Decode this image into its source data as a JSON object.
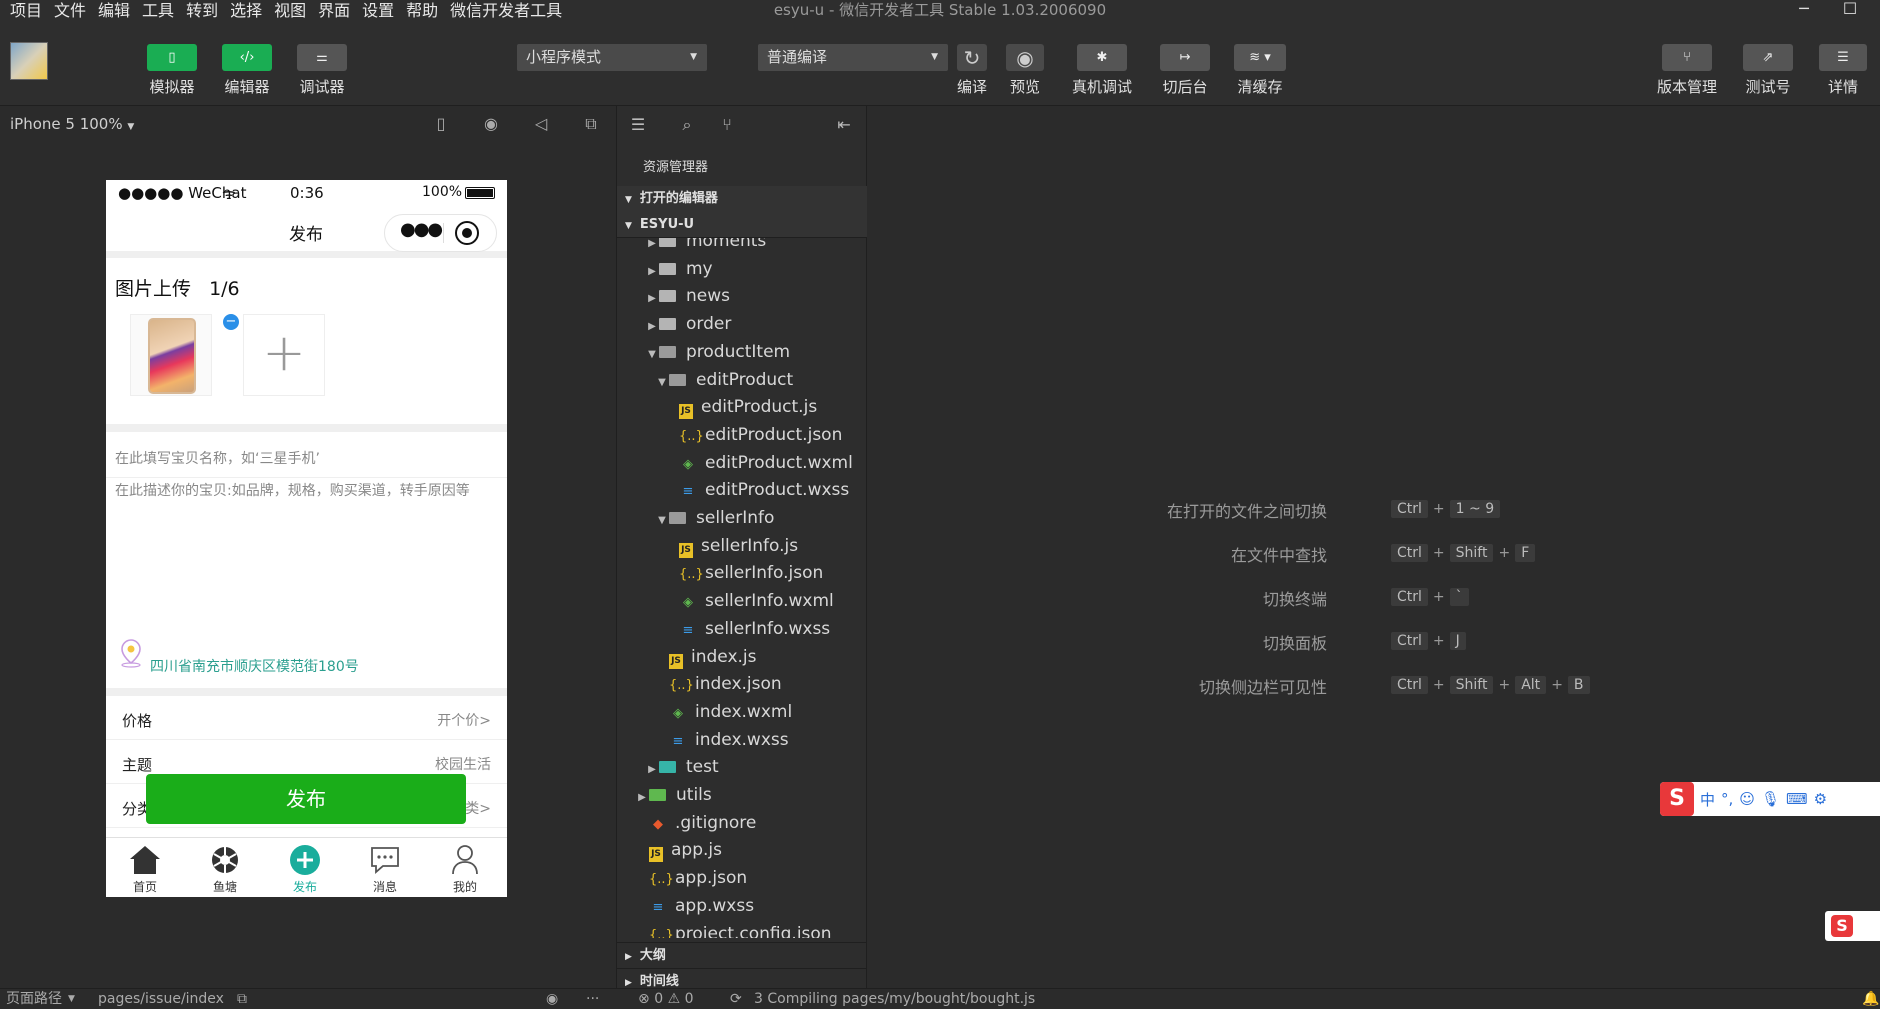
{
  "menubar": {
    "items": [
      "项目",
      "文件",
      "编辑",
      "工具",
      "转到",
      "选择",
      "视图",
      "界面",
      "设置",
      "帮助",
      "微信开发者工具"
    ],
    "title": "esyu-u - 微信开发者工具 Stable 1.03.2006090"
  },
  "toolbar": {
    "simulator": "模拟器",
    "editor": "编辑器",
    "debugger": "调试器",
    "mode_select": "小程序模式",
    "compile_select": "普通编译",
    "compile": "编译",
    "preview": "预览",
    "remote_debug": "真机调试",
    "background": "切后台",
    "clear_cache": "清缓存",
    "version": "版本管理",
    "test_account": "测试号",
    "details": "详情"
  },
  "simulator": {
    "device": "iPhone 5 100%",
    "status_carrier": "●●●●● WeChat",
    "status_time": "0:36",
    "status_battery": "100%",
    "nav_title": "发布",
    "upload_title": "图片上传",
    "upload_count": "1/6",
    "name_placeholder": "在此填写宝贝名称，如‘三星手机’",
    "desc_placeholder": "在此描述你的宝贝:如品牌，规格，购买渠道，转手原因等",
    "location": "四川省南充市顺庆区模范街180号",
    "rows": [
      {
        "label": "价格",
        "value": "开个价>"
      },
      {
        "label": "主题",
        "value": "校园生活"
      },
      {
        "label": "分类",
        "value": "类>"
      }
    ],
    "publish_button": "发布",
    "tabs": [
      "首页",
      "鱼塘",
      "发布",
      "消息",
      "我的"
    ]
  },
  "explorer": {
    "title": "资源管理器",
    "open_editors": "打开的编辑器",
    "project": "ESYU-U",
    "outline": "大纲",
    "timeline": "时间线",
    "tree": [
      {
        "name": "moments",
        "type": "folder"
      },
      {
        "name": "my",
        "type": "folder"
      },
      {
        "name": "news",
        "type": "folder"
      },
      {
        "name": "order",
        "type": "folder"
      },
      {
        "name": "productItem",
        "type": "folder-open"
      },
      {
        "name": "editProduct",
        "type": "folder-open"
      },
      {
        "name": "editProduct.js",
        "type": "js"
      },
      {
        "name": "editProduct.json",
        "type": "json"
      },
      {
        "name": "editProduct.wxml",
        "type": "wxml"
      },
      {
        "name": "editProduct.wxss",
        "type": "wxss"
      },
      {
        "name": "sellerInfo",
        "type": "folder-open"
      },
      {
        "name": "sellerInfo.js",
        "type": "js"
      },
      {
        "name": "sellerInfo.json",
        "type": "json"
      },
      {
        "name": "sellerInfo.wxml",
        "type": "wxml"
      },
      {
        "name": "sellerInfo.wxss",
        "type": "wxss"
      },
      {
        "name": "index.js",
        "type": "js"
      },
      {
        "name": "index.json",
        "type": "json"
      },
      {
        "name": "index.wxml",
        "type": "wxml"
      },
      {
        "name": "index.wxss",
        "type": "wxss"
      },
      {
        "name": "test",
        "type": "folder-teal"
      },
      {
        "name": "utils",
        "type": "folder-green"
      },
      {
        "name": ".gitignore",
        "type": "git"
      },
      {
        "name": "app.js",
        "type": "js"
      },
      {
        "name": "app.json",
        "type": "json"
      },
      {
        "name": "app.wxss",
        "type": "wxss"
      },
      {
        "name": "project.config.json",
        "type": "json"
      }
    ]
  },
  "shortcuts": [
    {
      "label": "在打开的文件之间切换",
      "keys": [
        "Ctrl",
        "1 ~ 9"
      ]
    },
    {
      "label": "在文件中查找",
      "keys": [
        "Ctrl",
        "Shift",
        "F"
      ]
    },
    {
      "label": "切换终端",
      "keys": [
        "Ctrl",
        "`"
      ]
    },
    {
      "label": "切换面板",
      "keys": [
        "Ctrl",
        "J"
      ]
    },
    {
      "label": "切换侧边栏可见性",
      "keys": [
        "Ctrl",
        "Shift",
        "Alt",
        "B"
      ]
    }
  ],
  "statusbar": {
    "page_path_label": "页面路径",
    "page_path": "pages/issue/index",
    "errors": "0",
    "warnings": "0",
    "compiling": "3 Compiling pages/my/bought/bought.js"
  },
  "colors": {
    "green": "#1aad53",
    "tab_active": "#1aad9c",
    "location": "#2b9f8f"
  }
}
